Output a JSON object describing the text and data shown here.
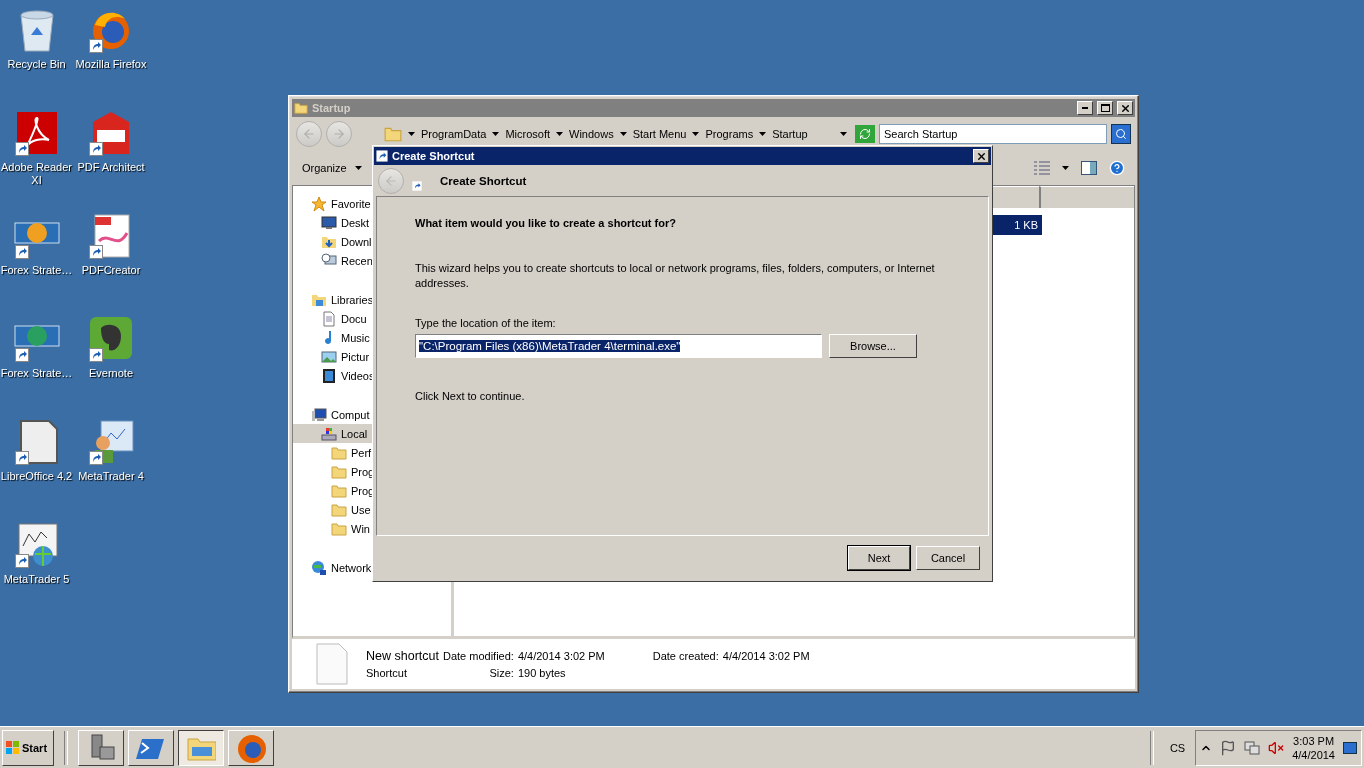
{
  "desktop": {
    "icons": [
      {
        "label": "Recycle Bin",
        "shortcut": false
      },
      {
        "label": "Mozilla Firefox",
        "shortcut": true
      },
      {
        "label": "Adobe Reader XI",
        "shortcut": true
      },
      {
        "label": "PDF Architect",
        "shortcut": true
      },
      {
        "label": "Forex Strate…",
        "shortcut": true
      },
      {
        "label": "PDFCreator",
        "shortcut": true
      },
      {
        "label": "Forex Strate…",
        "shortcut": true
      },
      {
        "label": "Evernote",
        "shortcut": true
      },
      {
        "label": "LibreOffice 4.2",
        "shortcut": true
      },
      {
        "label": "MetaTrader 4",
        "shortcut": true
      },
      {
        "label": "MetaTrader 5",
        "shortcut": true
      }
    ]
  },
  "explorer": {
    "title": "Startup",
    "breadcrumb": [
      "ProgramData",
      "Microsoft",
      "Windows",
      "Start Menu",
      "Programs",
      "Startup"
    ],
    "search": {
      "placeholder": "Search Startup"
    },
    "organize": "Organize",
    "nav": [
      {
        "label": "Favorite",
        "kind": "star",
        "selected": false,
        "children": [
          {
            "label": "Deskt",
            "kind": "desktop",
            "selected": false
          },
          {
            "label": "Downl",
            "kind": "download",
            "selected": false
          },
          {
            "label": "Recen",
            "kind": "recent",
            "selected": false
          }
        ]
      },
      {
        "label": "Libraries",
        "kind": "library",
        "selected": false,
        "children": [
          {
            "label": "Docu",
            "kind": "document",
            "selected": false
          },
          {
            "label": "Music",
            "kind": "music",
            "selected": false
          },
          {
            "label": "Pictur",
            "kind": "picture",
            "selected": false
          },
          {
            "label": "Videos",
            "kind": "video",
            "selected": false
          }
        ]
      },
      {
        "label": "Comput",
        "kind": "computer",
        "selected": false,
        "children": [
          {
            "label": "Local",
            "kind": "drive",
            "selected": true,
            "children": [
              {
                "label": "Perf",
                "kind": "folder",
                "selected": false
              },
              {
                "label": "Prog",
                "kind": "folder",
                "selected": false
              },
              {
                "label": "Prog",
                "kind": "folder",
                "selected": false
              },
              {
                "label": "Use",
                "kind": "folder",
                "selected": false
              },
              {
                "label": "Win",
                "kind": "folder",
                "selected": false
              }
            ]
          }
        ]
      },
      {
        "label": "Network",
        "kind": "network",
        "selected": false
      }
    ],
    "files": [
      {
        "size": "1 KB",
        "selected": true
      }
    ],
    "details": {
      "name": "New shortcut",
      "type": "Shortcut",
      "modified_label": "Date modified:",
      "modified": "4/4/2014 3:02 PM",
      "size_label": "Size:",
      "size": "190 bytes",
      "created_label": "Date created:",
      "created": "4/4/2014 3:02 PM"
    }
  },
  "dialog": {
    "title": "Create Shortcut",
    "header": "Create Shortcut",
    "question": "What item would you like to create a shortcut for?",
    "description": "This wizard helps you to create shortcuts to local or network programs, files, folders, computers, or Internet addresses.",
    "location_label": "Type the location of the item:",
    "location": "\"C:\\Program Files (x86)\\MetaTrader 4\\terminal.exe\"",
    "browse": "Browse...",
    "hint": "Click Next to continue.",
    "buttons": [
      "Next",
      "Cancel"
    ]
  },
  "taskbar": {
    "start": "Start",
    "apps": [
      {
        "selected": false
      },
      {
        "selected": false
      },
      {
        "selected": true
      },
      {
        "selected": false
      }
    ],
    "language": "CS",
    "time": "3:03 PM",
    "date": "4/4/2014"
  }
}
